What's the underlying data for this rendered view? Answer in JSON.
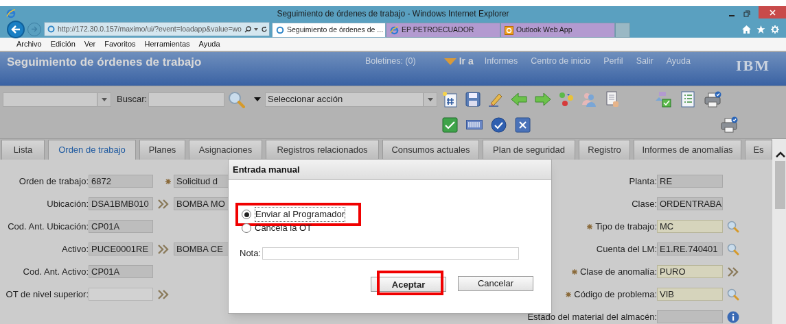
{
  "window": {
    "title": "Seguimiento de órdenes de trabajo - Windows Internet Explorer"
  },
  "browser": {
    "url": "http://172.30.0.157/maximo/ui/?event=loadapp&value=wo",
    "tabs": [
      {
        "label": "Seguimiento de órdenes de ...",
        "selected": true,
        "kind": "page"
      },
      {
        "label": "EP PETROECUADOR",
        "selected": false,
        "kind": "ie"
      },
      {
        "label": "Outlook Web App",
        "selected": false,
        "kind": "outlook"
      }
    ],
    "menu": [
      "Archivo",
      "Edición",
      "Ver",
      "Favoritos",
      "Herramientas",
      "Ayuda"
    ]
  },
  "app": {
    "title": "Seguimiento de órdenes de trabajo",
    "logo": "IBM",
    "nav": [
      {
        "label": "Boletines: (0)",
        "kind": "link"
      },
      {
        "label": "Ir a",
        "kind": "goto"
      },
      {
        "label": "Informes",
        "kind": "link"
      },
      {
        "label": "Centro de inicio",
        "kind": "link"
      },
      {
        "label": "Perfil",
        "kind": "link"
      },
      {
        "label": "Salir",
        "kind": "link"
      },
      {
        "label": "Ayuda",
        "kind": "link"
      }
    ]
  },
  "toolbar": {
    "search_label": "Buscar:",
    "action": "Seleccionar acción"
  },
  "tabs": [
    {
      "label": "Lista",
      "selected": false
    },
    {
      "label": "Orden de trabajo",
      "selected": true
    },
    {
      "label": "Planes",
      "selected": false
    },
    {
      "label": "Asignaciones",
      "selected": false
    },
    {
      "label": "Registros relacionados",
      "selected": false
    },
    {
      "label": "Consumos actuales",
      "selected": false
    },
    {
      "label": "Plan de seguridad",
      "selected": false
    },
    {
      "label": "Registro",
      "selected": false
    },
    {
      "label": "Informes de anomalías",
      "selected": false
    },
    {
      "label": "Es",
      "selected": false
    }
  ],
  "form": {
    "left": [
      {
        "label": "Orden de trabajo:",
        "value": "6872",
        "editable": false,
        "required": false,
        "description": "Solicitud d",
        "description_required": true
      },
      {
        "label": "Ubicación:",
        "value": "DSA1BMB010",
        "editable": false,
        "required": false,
        "kind": "link",
        "description": "BOMBA MO"
      },
      {
        "label": "Cod. Ant. Ubicación:",
        "value": "CP01A",
        "editable": false,
        "required": false
      },
      {
        "label": "Activo:",
        "value": "PUCE0001RE",
        "editable": false,
        "required": false,
        "kind": "link",
        "description": "BOMBA CE"
      },
      {
        "label": "Cod. Ant. Activo:",
        "value": "CP01A",
        "editable": false,
        "required": false
      },
      {
        "label": "OT de nivel superior:",
        "editable": true,
        "required": false,
        "kind": "link"
      }
    ],
    "right": [
      {
        "label": "Planta:",
        "value": "RE",
        "editable": false,
        "required": false
      },
      {
        "label": "Clase:",
        "value": "ORDENTRABA",
        "editable": false,
        "required": false
      },
      {
        "label": "Tipo de trabajo:",
        "value": "MC",
        "editable": true,
        "required": true,
        "kind": "lookup"
      },
      {
        "label": "Cuenta del LM:",
        "value": "E1.RE.740401",
        "editable": false,
        "required": false,
        "kind": "lookup"
      },
      {
        "label": "Clase de anomalía:",
        "value": "PURO",
        "editable": true,
        "required": true,
        "kind": "link"
      },
      {
        "label": "Código de problema:",
        "value": "VIB",
        "editable": true,
        "required": true,
        "kind": "lookup"
      },
      {
        "label": "Estado del material del almacén:",
        "editable": false,
        "required": false,
        "kind": "info"
      }
    ]
  },
  "dialog": {
    "title": "Entrada manual",
    "options": [
      {
        "label": "Enviar al Programador",
        "selected": true,
        "highlighted": true
      },
      {
        "label": "Cancela la OT",
        "selected": false,
        "highlighted": false
      }
    ],
    "note_label": "Nota:",
    "buttons": [
      {
        "label": "Aceptar",
        "default": true,
        "highlighted": true
      },
      {
        "label": "Cancelar",
        "default": false,
        "highlighted": false
      }
    ]
  }
}
